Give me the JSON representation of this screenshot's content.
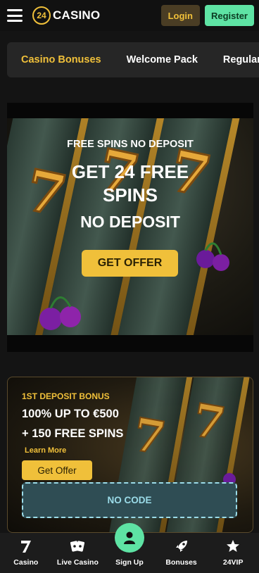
{
  "header": {
    "logo_number": "24",
    "logo_text": "CASINO",
    "login_label": "Login",
    "register_label": "Register"
  },
  "tabs": [
    {
      "label": "Casino Bonuses",
      "active": true
    },
    {
      "label": "Welcome Pack",
      "active": false
    },
    {
      "label": "Regular Bo",
      "active": false
    }
  ],
  "hero": {
    "eyebrow": "FREE SPINS NO DEPOSIT",
    "title": "GET 24 FREE SPINS",
    "subtitle": "NO DEPOSIT",
    "cta_label": "GET OFFER"
  },
  "bonus_card": {
    "eyebrow": "1ST DEPOSIT BONUS",
    "line1": "100% UP TO €500",
    "line2": "+ 150 FREE SPINS",
    "learn_more": "Learn More",
    "button_label": "Get Offer",
    "code_label": "NO CODE"
  },
  "bottom_nav": [
    {
      "label": "Casino",
      "icon": "seven-icon"
    },
    {
      "label": "Live Casino",
      "icon": "cards-icon"
    },
    {
      "label": "Sign Up",
      "icon": "user-icon"
    },
    {
      "label": "Bonuses",
      "icon": "rocket-icon"
    },
    {
      "label": "24VIP",
      "icon": "star-icon"
    }
  ],
  "colors": {
    "accent": "#f0c03a",
    "register": "#5ee3a4",
    "code_border": "#9bdbe8"
  }
}
